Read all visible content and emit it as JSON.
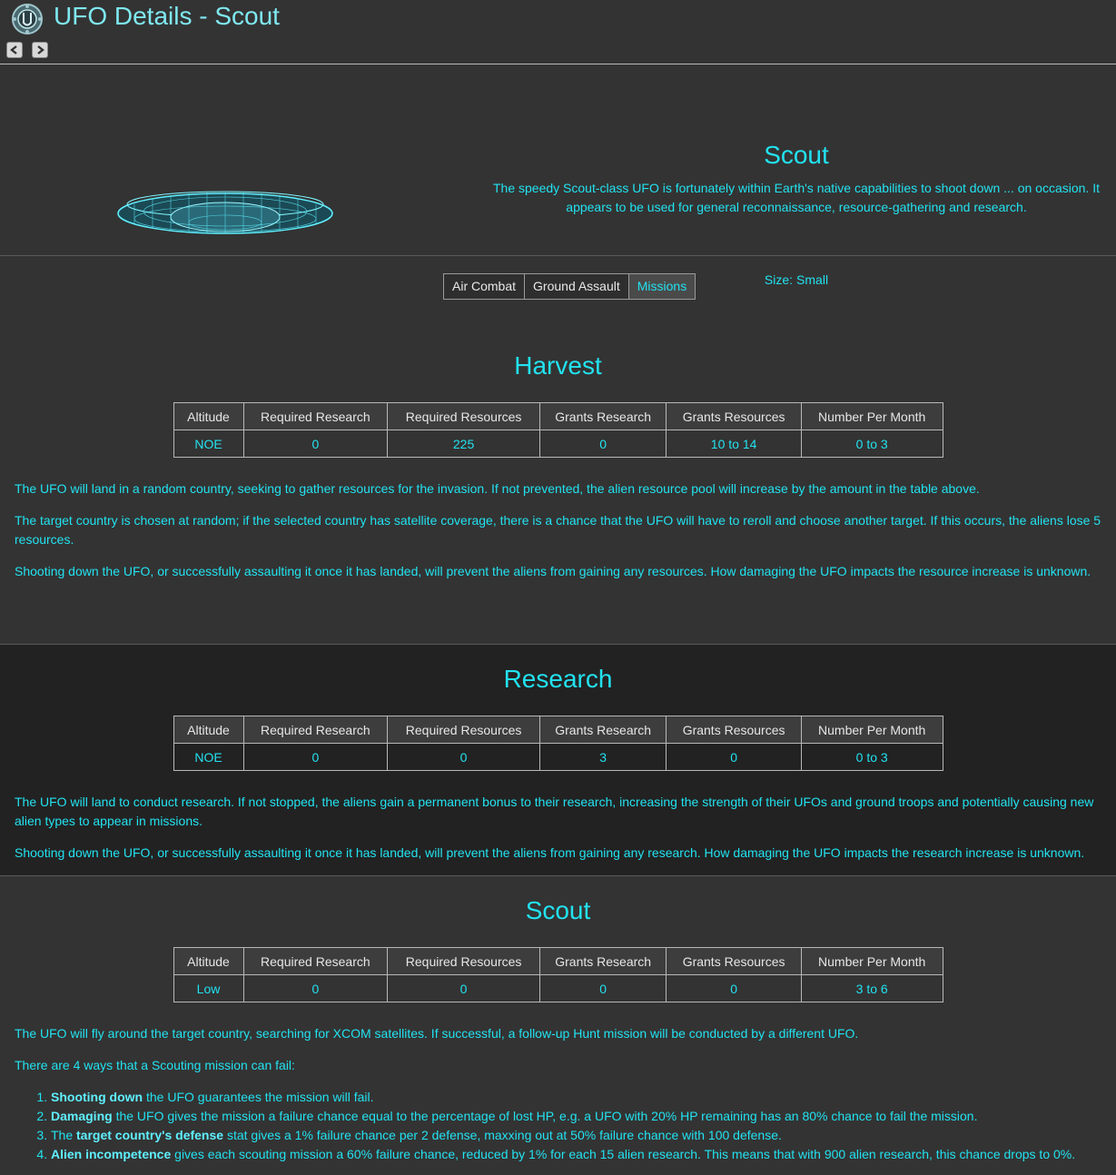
{
  "window": {
    "title": "UFO Details - Scout"
  },
  "nav": {
    "prev_icon": "chevron-left-icon",
    "next_icon": "chevron-right-icon"
  },
  "ufo": {
    "name": "Scout",
    "description": "The speedy Scout-class UFO is fortunately within Earth's native capabilities to shoot down ... on occasion. It appears to be used for general reconnaissance, resource-gathering and research.",
    "size_label": "Size:",
    "size_value": "Small"
  },
  "tabs": [
    {
      "label": "Air Combat",
      "active": false
    },
    {
      "label": "Ground Assault",
      "active": false
    },
    {
      "label": "Missions",
      "active": true
    }
  ],
  "table_headers": [
    "Altitude",
    "Required Research",
    "Required Resources",
    "Grants Research",
    "Grants Resources",
    "Number Per Month"
  ],
  "missions": {
    "harvest": {
      "title": "Harvest",
      "row": [
        "NOE",
        "0",
        "225",
        "0",
        "10 to 14",
        "0 to 3"
      ],
      "paragraphs": [
        "The UFO will land in a random country, seeking to gather resources for the invasion. If not prevented, the alien resource pool will increase by the amount in the table above.",
        "The target country is chosen at random; if the selected country has satellite coverage, there is a chance that the UFO will have to reroll and choose another target. If this occurs, the aliens lose 5 resources.",
        "Shooting down the UFO, or successfully assaulting it once it has landed, will prevent the aliens from gaining any resources. How damaging the UFO impacts the resource increase is unknown."
      ]
    },
    "research": {
      "title": "Research",
      "row": [
        "NOE",
        "0",
        "0",
        "3",
        "0",
        "0 to 3"
      ],
      "paragraphs": [
        "The UFO will land to conduct research. If not stopped, the aliens gain a permanent bonus to their research, increasing the strength of their UFOs and ground troops and potentially causing new alien types to appear in missions.",
        "Shooting down the UFO, or successfully assaulting it once it has landed, will prevent the aliens from gaining any research. How damaging the UFO impacts the research increase is unknown."
      ]
    },
    "scout": {
      "title": "Scout",
      "row": [
        "Low",
        "0",
        "0",
        "0",
        "0",
        "3 to 6"
      ],
      "paragraphs": [
        "The UFO will fly around the target country, searching for XCOM satellites. If successful, a follow-up Hunt mission will be conducted by a different UFO.",
        "There are 4 ways that a Scouting mission can fail:"
      ],
      "fail_list": [
        {
          "bold": "Shooting down",
          "text": " the UFO guarantees the mission will fail."
        },
        {
          "bold": "Damaging",
          "text": " the UFO gives the mission a failure chance equal to the percentage of lost HP, e.g. a UFO with 20% HP remaining has an 80% chance to fail the mission."
        },
        {
          "prefix": "The ",
          "bold": "target country's defense",
          "text": " stat gives a 1% failure chance per 2 defense, maxxing out at 50% failure chance with 100 defense."
        },
        {
          "bold": "Alien incompetence",
          "text": " gives each scouting mission a 60% failure chance, reduced by 1% for each 15 alien research. This means that with 900 alien research, this chance drops to 0%."
        }
      ]
    }
  }
}
